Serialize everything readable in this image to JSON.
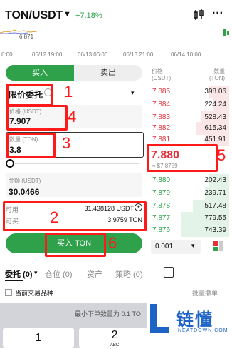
{
  "header": {
    "pair": "TON/USDT",
    "change": "+7.18%",
    "mini_price": "6.871"
  },
  "time_axis": [
    "6:00",
    "06/12 19:00",
    "06/13 06:00",
    "06/13 21:00",
    "06/14 10:00"
  ],
  "tabs": {
    "buy": "买入",
    "sell": "卖出"
  },
  "order_type": "限价委托",
  "price_field": {
    "label": "价格 (USDT)",
    "value": "7.907"
  },
  "qty_field": {
    "label": "数量 (TON)",
    "value": "3.8"
  },
  "amount_field": {
    "label": "金额 (USDT)",
    "value": "30.0466"
  },
  "available": {
    "label": "可用",
    "value": "31.438128 USDT",
    "buyable_label": "可买",
    "buyable_value": "3.9759 TON"
  },
  "buy_button": "买入 TON",
  "orderbook": {
    "col_price": "价格\n(USDT)",
    "col_qty": "数量\n(TON)",
    "asks": [
      {
        "price": "7.885",
        "qty": "398.06",
        "depth": 0.25
      },
      {
        "price": "7.884",
        "qty": "224.24",
        "depth": 0.2
      },
      {
        "price": "7.883",
        "qty": "528.43",
        "depth": 0.35
      },
      {
        "price": "7.882",
        "qty": "615.34",
        "depth": 0.4
      },
      {
        "price": "7.881",
        "qty": "451.91",
        "depth": 0.3
      }
    ],
    "mid_price": "7.880",
    "mid_sub": "≈ $7.8759",
    "bids": [
      {
        "price": "7.880",
        "qty": "202.43",
        "depth": 0.25
      },
      {
        "price": "7.879",
        "qty": "239.71",
        "depth": 0.3
      },
      {
        "price": "7.878",
        "qty": "517.48",
        "depth": 0.45
      },
      {
        "price": "7.877",
        "qty": "779.55",
        "depth": 0.6
      },
      {
        "price": "7.876",
        "qty": "743.39",
        "depth": 0.6
      }
    ],
    "precision": "0.001"
  },
  "bottom_tabs": {
    "orders": "委托 (0)",
    "positions": "仓位 (0)",
    "assets": "资产",
    "strategy": "策略 (0)"
  },
  "current_pair_label": "当前交易品种",
  "batch_label": "批量撤单",
  "min_order": "最小下单数量为 0.1 TO",
  "keys": [
    "1",
    "2"
  ],
  "key_sub": "ABC",
  "annotations": [
    "1",
    "2",
    "3",
    "4",
    "5",
    "6"
  ],
  "watermark": {
    "text": "链懂",
    "url": "NEATDOWN.COM"
  },
  "colors": {
    "buy": "#2fa14b",
    "sell": "#e0313b",
    "annotation": "#ff1a1a"
  }
}
